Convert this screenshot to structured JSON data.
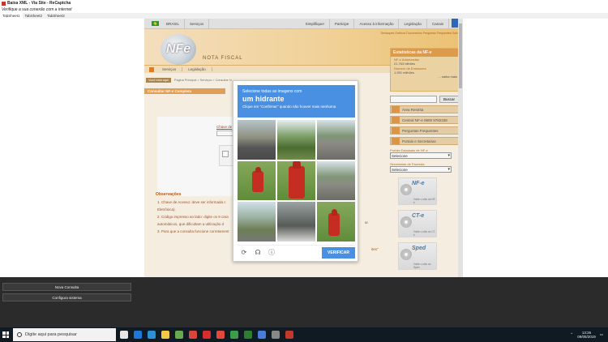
{
  "app": {
    "title": "Baixa XML - Via Site - ReCaptcha",
    "subtitle": "Verifique a sua conexão com a internet",
    "tabs": [
      "TabSheet1",
      "TabSheet2",
      "TabSheet3"
    ]
  },
  "site": {
    "topnav": {
      "country": "BRASIL",
      "services": "Serviços",
      "items": [
        "Simplifique!",
        "Participe",
        "Acesso à informação",
        "Legislação",
        "Canais"
      ]
    },
    "banner": {
      "logo_text": "NF",
      "logo_letter": "e",
      "nota_fiscal": "NOTA FISCAL",
      "sitelinks": "Destaques   Gráficos   Documentos   Perguntas Frequentes   Outros"
    },
    "menu": [
      "Serviços",
      "Legislação"
    ],
    "crumb_you": "Você está aqui",
    "crumb_path": "Página Principal > Serviços > Consultar N...",
    "page_title": "Consultar NF-e Completa",
    "form_label": "Chave de",
    "observacoes": {
      "title": "Observações",
      "items": [
        "1.  Chave de Acesso: deve ser informada c",
        "Eletrônica).",
        "2.  Código impresso ao lado: digite os 9 cara",
        "automáticos, que dificultam a utilização d",
        "3.  Para que a consulta funcione corretament"
      ],
      "tail_1": "ar",
      "tail_2": "ites\""
    },
    "sidebar": {
      "stats_title": "Estatísticas da NF-e",
      "stat1_label": "NF-e Autorizadas",
      "stat1_value": "21.763 bilhões",
      "stat2_label": "Número de Emissores",
      "stat2_value": "1.931 milhões",
      "more": "... saiba mais",
      "search_button": "Buscar",
      "links": [
        "Área Restrita",
        "Central NF-e 0800 9782338",
        "Perguntas Frequentes",
        "Portais e Secretarias"
      ],
      "portal_label": "Portais Estaduais de NF-e",
      "portal_value": "Selecione",
      "secretaria_label": "Secretarias de Fazenda",
      "secretaria_value": "Selecione",
      "promos": [
        {
          "badge": "NF-e",
          "caption": "Visite o sítio da NF-e"
        },
        {
          "badge": "CT-e",
          "caption": "Visite o sítio do CT-e"
        },
        {
          "badge": "Sped",
          "caption": "Visite o sítio do Sped"
        }
      ]
    }
  },
  "captcha": {
    "line1": "Selecione todas as imagens com",
    "target": "um hidrante",
    "line3": "Clique em \"Confirmar\" quando não houver mais nenhuma",
    "verify": "VERIFICAR",
    "reload_glyph": "⟳",
    "audio_glyph": "☊",
    "info_glyph": "ⓘ"
  },
  "bottom": {
    "nova_consulta": "Nova Consulta",
    "configura_sistema": "Configura sistema"
  },
  "taskbar": {
    "search_placeholder": "Digite aqui para pesquisar",
    "time": "13:26",
    "date": "09/05/2019"
  }
}
